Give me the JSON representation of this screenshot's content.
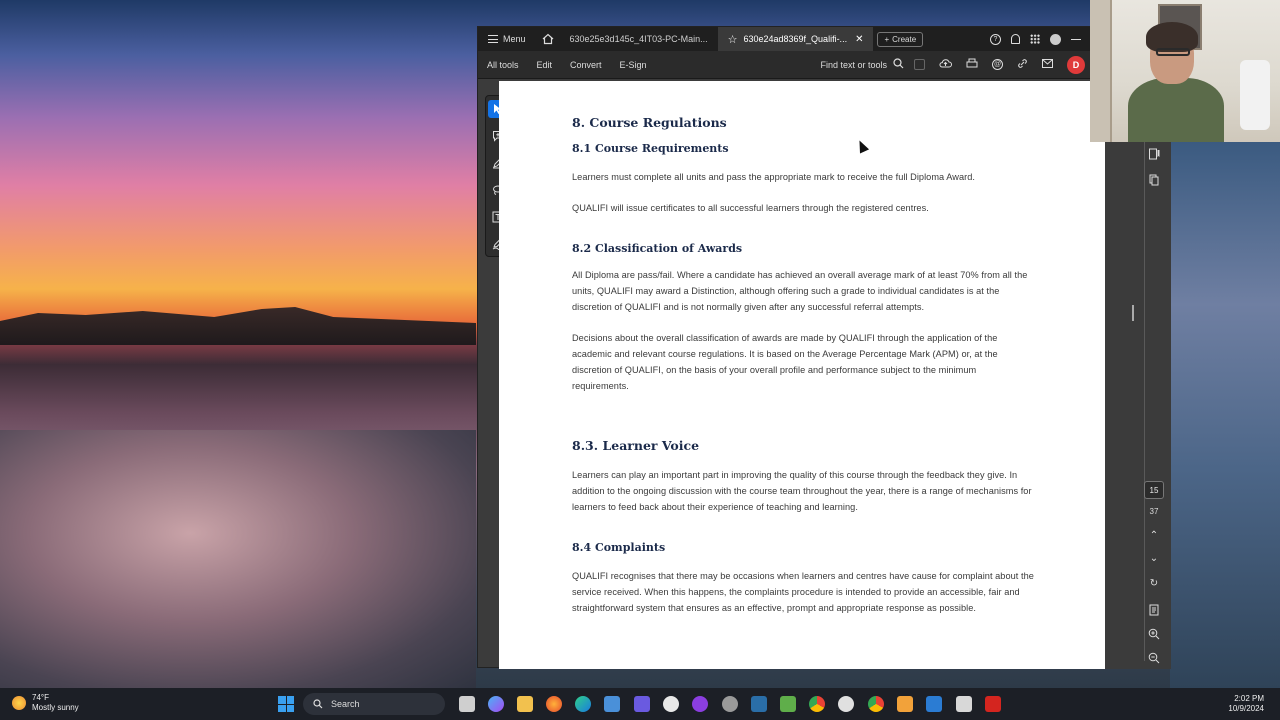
{
  "tabs": {
    "menu": "Menu",
    "tab1": "630e25e3d145c_4IT03-PC-Main...",
    "tab2": "630e24ad8369f_Qualifi-...",
    "create": "Create"
  },
  "toolbar": {
    "all_tools": "All tools",
    "edit": "Edit",
    "convert": "Convert",
    "esign": "E-Sign",
    "find": "Find text or tools"
  },
  "document": {
    "h_8": "8. Course Regulations",
    "h_81": "8.1 Course Requirements",
    "p_81a": "Learners must complete all units and pass the appropriate mark to receive the full Diploma Award.",
    "p_81b": "QUALIFI will issue certificates to all successful learners through the registered centres.",
    "h_82": "8.2 Classification of Awards",
    "p_82a": "All Diploma are pass/fail. Where a candidate has achieved an overall average mark of at least 70% from all the units, QUALIFI may award a Distinction, although offering such a grade to individual candidates is at the discretion of QUALIFI and is not normally given after any successful referral attempts.",
    "p_82b": "Decisions about the overall classification of awards are made by QUALIFI through the application of the academic and relevant course regulations. It is based on the Average Percentage Mark (APM) or, at the discretion of QUALIFI, on the basis of your overall profile and performance subject to the minimum requirements.",
    "h_83": "8.3. Learner Voice",
    "p_83": "Learners can play an important part in improving the quality of this course through the feedback they give. In addition to the ongoing discussion with the course team throughout the year, there is a range of mechanisms for learners to feed back about their experience of teaching and learning.",
    "h_84": "8.4 Complaints",
    "p_84": "QUALIFI recognises that there may be occasions when learners and centres have cause for complaint about the service received. When this happens, the complaints procedure is intended to provide an accessible, fair and straightforward system that ensures as an effective, prompt and appropriate response as possible."
  },
  "pagination": {
    "current": "15",
    "total": "37"
  },
  "taskbar": {
    "temp": "74°F",
    "weather": "Mostly sunny",
    "search": "Search",
    "time": "2:02 PM",
    "date": "10/9/2024"
  },
  "colors": {
    "accent": "#1473e6",
    "heading": "#1b2a4a",
    "badge": "#e03a3a"
  }
}
